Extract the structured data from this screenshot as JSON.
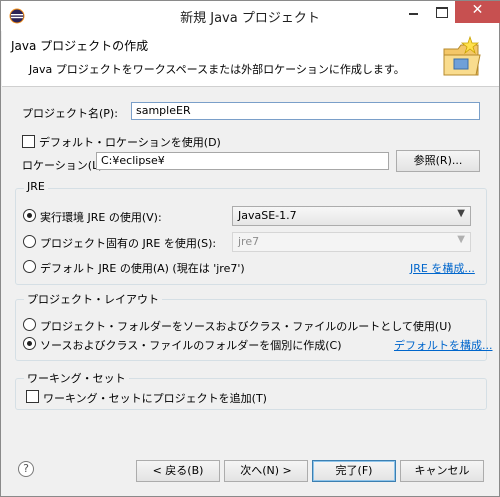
{
  "window": {
    "title": "新規 Java プロジェクト",
    "close_glyph": "✕"
  },
  "header": {
    "title": "Java プロジェクトの作成",
    "description": "Java プロジェクトをワークスペースまたは外部ロケーションに作成します。"
  },
  "project": {
    "name_label": "プロジェクト名(P):",
    "name_value": "sampleER",
    "default_location_label": "デフォルト・ロケーションを使用(D)",
    "default_location_checked": false,
    "location_label": "ロケーション(L):",
    "location_value": "C:¥eclipse¥",
    "browse_label": "参照(R)..."
  },
  "jre": {
    "group_title": "JRE",
    "options": [
      {
        "label": "実行環境 JRE の使用(V):",
        "selected": true,
        "value": "JavaSE-1.7"
      },
      {
        "label": "プロジェクト固有の JRE を使用(S):",
        "selected": false,
        "value": "jre7"
      },
      {
        "label": "デフォルト JRE の使用(A) (現在は 'jre7')",
        "selected": false
      }
    ],
    "configure_link": "JRE を構成..."
  },
  "layout": {
    "group_title": "プロジェクト・レイアウト",
    "options": [
      {
        "label": "プロジェクト・フォルダーをソースおよびクラス・ファイルのルートとして使用(U)",
        "selected": false
      },
      {
        "label": "ソースおよびクラス・ファイルのフォルダーを個別に作成(C)",
        "selected": true
      }
    ],
    "configure_link": "デフォルトを構成..."
  },
  "working_set": {
    "group_title": "ワーキング・セット",
    "add_label": "ワーキング・セットにプロジェクトを追加(T)",
    "add_checked": false
  },
  "footer": {
    "help_glyph": "?",
    "back_label": "< 戻る(B)",
    "next_label": "次へ(N) >",
    "finish_label": "完了(F)",
    "cancel_label": "キャンセル"
  },
  "icons": {
    "app": "eclipse-icon",
    "header": "new-java-project-wizard-icon",
    "dropdown": "chevron-down-icon",
    "help": "help-icon"
  }
}
